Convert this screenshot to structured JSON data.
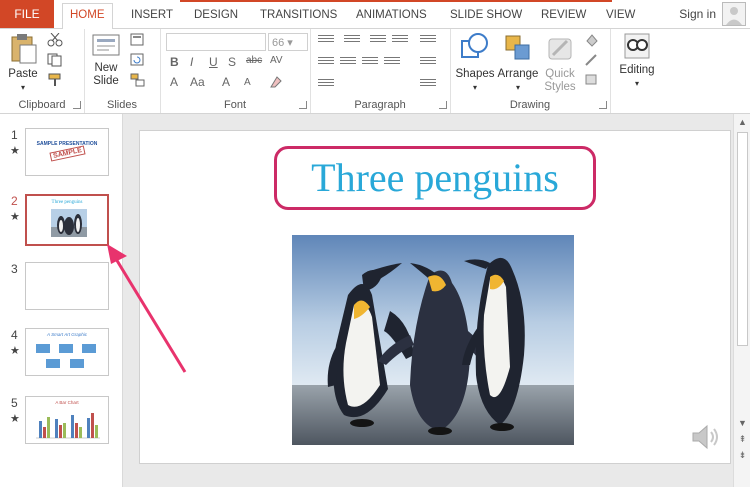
{
  "tabs": {
    "file": "FILE",
    "home": "HOME",
    "insert": "INSERT",
    "design": "DESIGN",
    "transitions": "TRANSITIONS",
    "animations": "ANIMATIONS",
    "slideshow": "SLIDE SHOW",
    "review": "REVIEW",
    "view": "VIEW"
  },
  "account": {
    "signin": "Sign in"
  },
  "ribbon": {
    "clipboard": {
      "label": "Clipboard",
      "paste": "Paste"
    },
    "slides": {
      "label": "Slides",
      "new_slide_line1": "New",
      "new_slide_line2": "Slide"
    },
    "font": {
      "label": "Font",
      "font_name": "",
      "font_size": "66",
      "bold": "B",
      "italic": "I",
      "underline": "U",
      "shadow": "S",
      "strike": "abc",
      "spacing": "AV",
      "color": "A",
      "case": "Aa",
      "grow": "A",
      "shrink": "A"
    },
    "paragraph": {
      "label": "Paragraph"
    },
    "drawing": {
      "label": "Drawing",
      "shapes": "Shapes",
      "arrange": "Arrange",
      "quick_styles_line1": "Quick",
      "quick_styles_line2": "Styles"
    },
    "editing": {
      "label": "Editing"
    }
  },
  "thumbnails": [
    {
      "number": "1",
      "star": "★",
      "text": "SAMPLE PRESENTATION",
      "stamp": "SAMPLE"
    },
    {
      "number": "2",
      "star": "★",
      "text": "Three penguins"
    },
    {
      "number": "3",
      "star": ""
    },
    {
      "number": "4",
      "star": "★",
      "text": "A Smart Art Graphic"
    },
    {
      "number": "5",
      "star": "★",
      "text": "A Bar Chart"
    }
  ],
  "slide": {
    "title": "Three penguins"
  },
  "colors": {
    "accent": "#d24726",
    "title_border": "#cc2a66",
    "title_text": "#29a8d8",
    "annotation_arrow": "#e8336d"
  },
  "icons": [
    "paste-icon",
    "cut-icon",
    "copy-icon",
    "format-painter-icon",
    "new-slide-icon",
    "layout-icon",
    "shapes-icon",
    "arrange-icon",
    "quick-styles-icon",
    "editing-icon",
    "audio-icon",
    "user-icon"
  ]
}
